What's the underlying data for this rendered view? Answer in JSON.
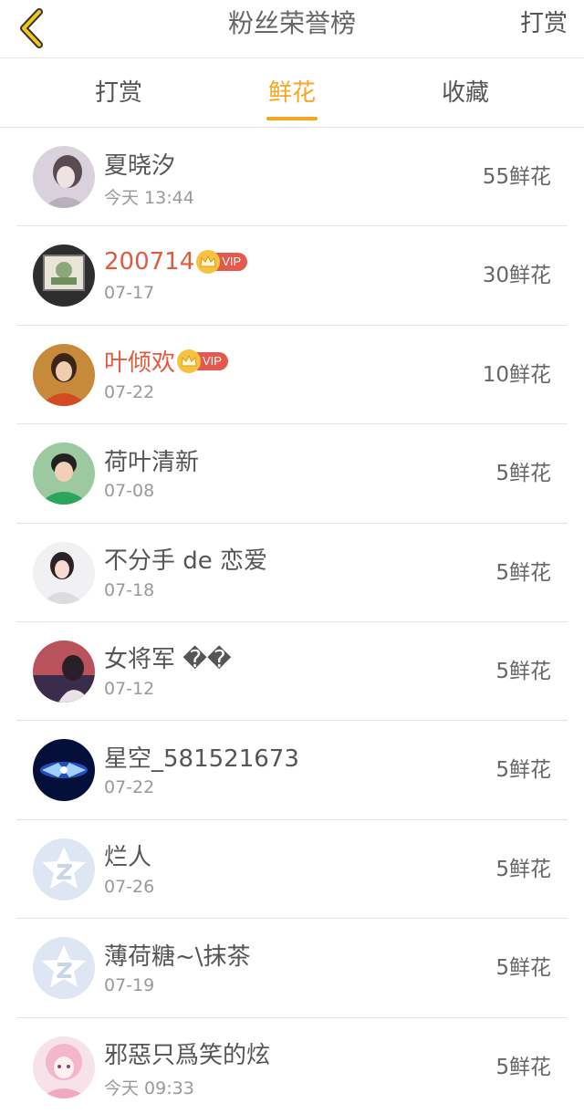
{
  "header": {
    "title": "粉丝荣誉榜",
    "action": "打赏"
  },
  "tabs": [
    {
      "label": "打赏"
    },
    {
      "label": "鲜花"
    },
    {
      "label": "收藏"
    }
  ],
  "accent_color": "#f5a623",
  "vip_name_color": "#e05a3e",
  "vip_label": "VIP",
  "fans": [
    {
      "name": "夏晓汐",
      "date": "今天 13:44",
      "amount": "55鲜花",
      "avatar_icon": "portrait-girl-icon"
    },
    {
      "name": "200714",
      "date": "07-17",
      "amount": "30鲜花",
      "avatar_icon": "framed-picture-icon"
    },
    {
      "name": "叶倾欢",
      "date": "07-22",
      "amount": "10鲜花",
      "avatar_icon": "portrait-woman-icon"
    },
    {
      "name": "荷叶清新",
      "date": "07-08",
      "amount": "5鲜花",
      "avatar_icon": "portrait-boy-icon"
    },
    {
      "name": "不分手 de 恋爱",
      "date": "07-18",
      "amount": "5鲜花",
      "avatar_icon": "portrait-girl-white-icon"
    },
    {
      "name": "女将军 ��",
      "date": "07-12",
      "amount": "5鲜花",
      "avatar_icon": "portrait-sunset-icon"
    },
    {
      "name": "星空_581521673",
      "date": "07-22",
      "amount": "5鲜花",
      "avatar_icon": "blue-glow-icon"
    },
    {
      "name": "烂人",
      "date": "07-26",
      "amount": "5鲜花",
      "avatar_icon": "default-star-avatar-icon"
    },
    {
      "name": "薄荷糖~\\抹茶",
      "date": "07-19",
      "amount": "5鲜花",
      "avatar_icon": "default-star-avatar-icon"
    },
    {
      "name": "邪惡只爲笑的炫",
      "date": "今天 09:33",
      "amount": "5鲜花",
      "avatar_icon": "anime-girl-icon"
    }
  ]
}
